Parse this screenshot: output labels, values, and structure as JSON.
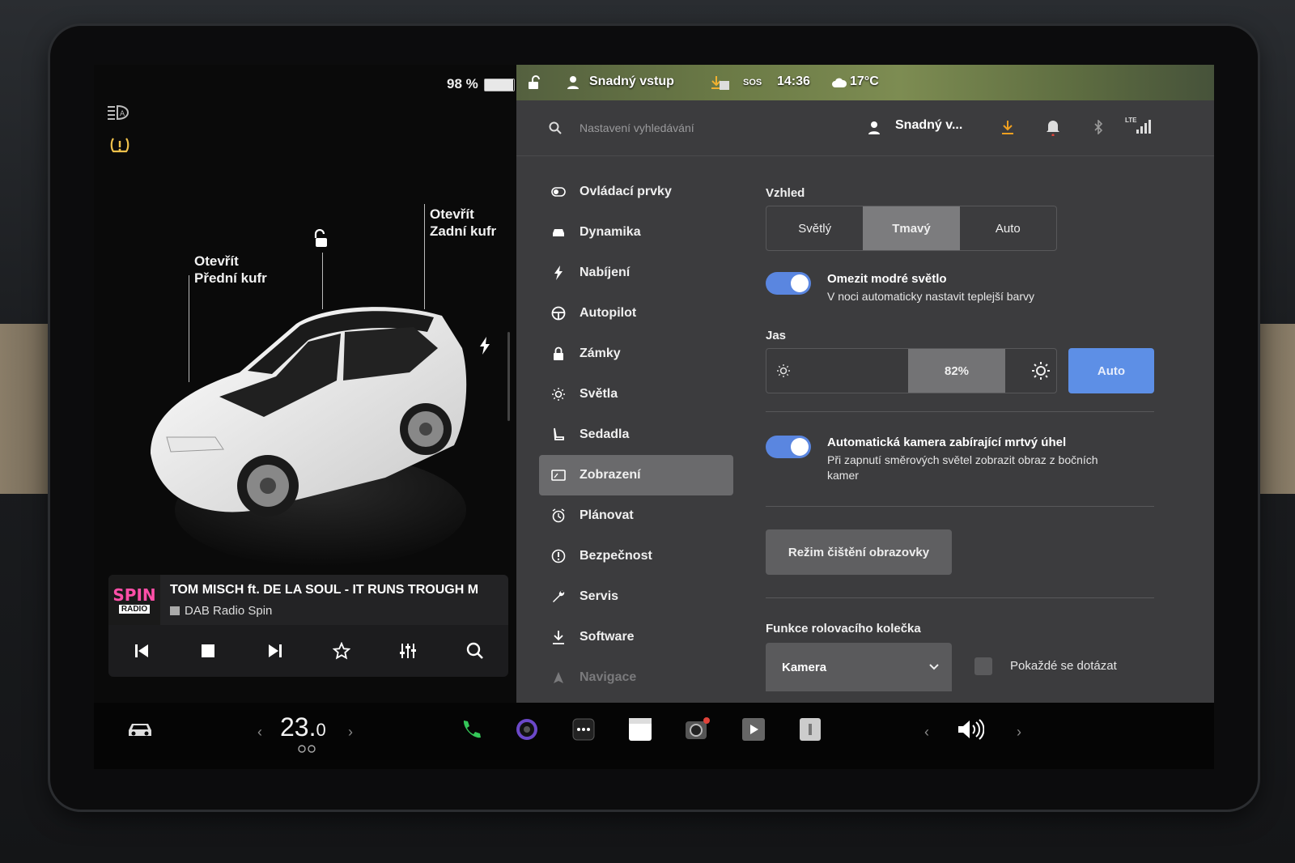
{
  "left": {
    "battery": "98 %",
    "battery_percent": 98,
    "callout_front": {
      "line1": "Otevřít",
      "line2": "Přední kufr"
    },
    "callout_rear": {
      "line1": "Otevřít",
      "line2": "Zadní kufr"
    }
  },
  "media": {
    "track": "TOM MISCH ft. DE LA SOUL - IT RUNS TROUGH M",
    "station": "DAB Radio Spin",
    "art_line1": "SPIN",
    "art_line2": "RADIO"
  },
  "status": {
    "profile": "Snadný vstup",
    "sos": "SOS",
    "time": "14:36",
    "temp": "17°C"
  },
  "topbar": {
    "search_placeholder": "Nastavení vyhledávání",
    "user": "Snadný v...",
    "lte": "LTE"
  },
  "nav": {
    "items": [
      {
        "label": "Ovládací prvky",
        "icon": "toggle-icon"
      },
      {
        "label": "Dynamika",
        "icon": "car-icon"
      },
      {
        "label": "Nabíjení",
        "icon": "bolt-icon"
      },
      {
        "label": "Autopilot",
        "icon": "steering-wheel-icon"
      },
      {
        "label": "Zámky",
        "icon": "lock-icon"
      },
      {
        "label": "Světla",
        "icon": "sun-icon"
      },
      {
        "label": "Sedadla",
        "icon": "seat-icon"
      },
      {
        "label": "Zobrazení",
        "icon": "display-icon"
      },
      {
        "label": "Plánovat",
        "icon": "clock-icon"
      },
      {
        "label": "Bezpečnost",
        "icon": "alert-icon"
      },
      {
        "label": "Servis",
        "icon": "wrench-icon"
      },
      {
        "label": "Software",
        "icon": "download-icon"
      },
      {
        "label": "Navigace",
        "icon": "navigation-icon"
      }
    ],
    "active": "Zobrazení"
  },
  "content": {
    "appearance_label": "Vzhled",
    "appearance_options": [
      "Světlý",
      "Tmavý",
      "Auto"
    ],
    "appearance_selected": "Tmavý",
    "blue_light_title": "Omezit modré světlo",
    "blue_light_sub": "V noci automaticky nastavit teplejší barvy",
    "blue_light_on": true,
    "brightness_label": "Jas",
    "brightness_value": "82%",
    "brightness_percent": 82,
    "brightness_auto": "Auto",
    "blindspot_title": "Automatická kamera zabírající mrtvý úhel",
    "blindspot_sub1": "Při zapnutí směrových světel zobrazit obraz z bočních",
    "blindspot_sub2": "kamer",
    "blindspot_on": true,
    "clean_button": "Režim čištění obrazovky",
    "scroll_label": "Funkce rolovacího kolečka",
    "scroll_value": "Kamera",
    "ask_label": "Pokaždé se dotázat"
  },
  "dock": {
    "temp_main": "23.",
    "temp_dec": "0"
  },
  "colors": {
    "accent": "#5a86e0",
    "active_bg": "#6a6a6c",
    "panel": "#3c3c3e"
  }
}
